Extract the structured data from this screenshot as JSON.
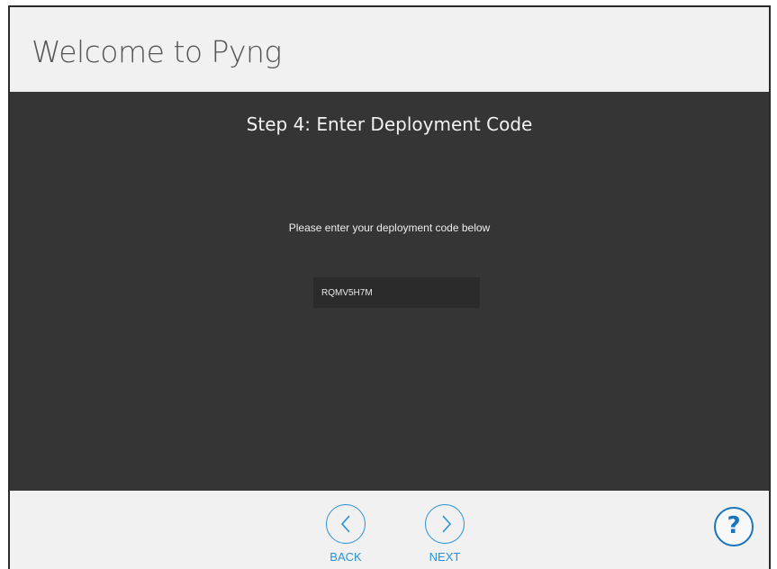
{
  "header": {
    "title": "Welcome to Pyng"
  },
  "main": {
    "step_title": "Step 4: Enter Deployment Code",
    "instruction": "Please enter your deployment code below",
    "code_input": {
      "value": "RQMV5H7M",
      "placeholder": ""
    }
  },
  "footer": {
    "back_label": "BACK",
    "next_label": "NEXT",
    "help_label": "?",
    "back_icon": "chevron-left-icon",
    "next_icon": "chevron-right-icon",
    "help_icon": "question-icon"
  },
  "colors": {
    "accent": "#2a91d4",
    "help": "#1b75bb",
    "panel": "#353535",
    "header_bg": "#f1f1f1"
  }
}
